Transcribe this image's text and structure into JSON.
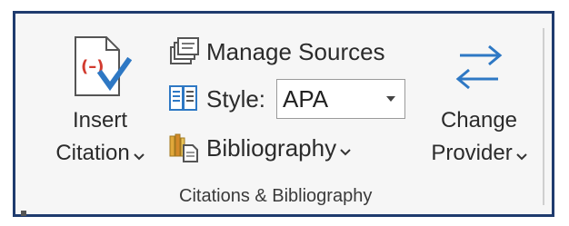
{
  "ribbon": {
    "insert_citation": {
      "line1": "Insert",
      "line2": "Citation",
      "icon": "insert-citation-icon"
    },
    "manage_sources": {
      "label": "Manage Sources",
      "icon": "manage-sources-icon"
    },
    "style": {
      "label": "Style:",
      "value": "APA",
      "icon": "style-icon"
    },
    "bibliography": {
      "label": "Bibliography",
      "icon": "bibliography-icon"
    },
    "change_provider": {
      "line1": "Change",
      "line2": "Provider",
      "icon": "change-provider-icon"
    },
    "group_label": "Citations & Bibliography"
  },
  "colors": {
    "frame_border": "#1f3b6e",
    "accent_blue": "#2e78c4",
    "accent_red": "#d23b2f",
    "text": "#2b2b2b"
  }
}
